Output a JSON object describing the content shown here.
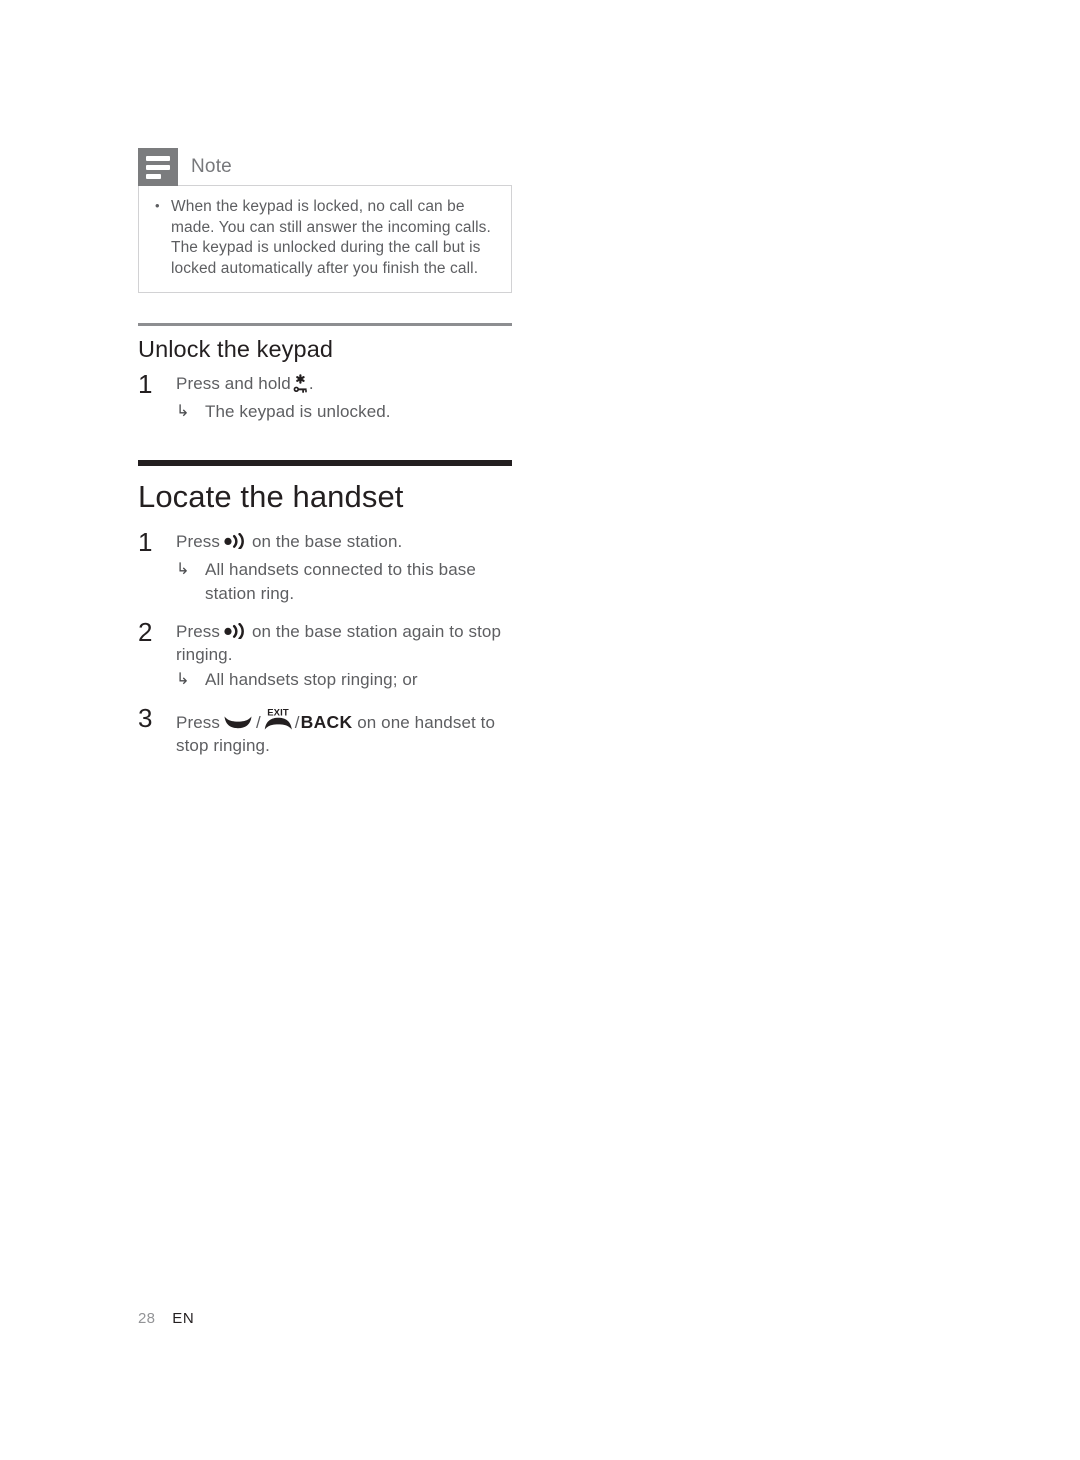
{
  "note": {
    "icon_name": "note-lines-icon",
    "title": "Note",
    "bullets": [
      "When the keypad is locked, no call can be made. You can still answer the incoming calls. The keypad is unlocked during the call but is locked automatically after you finish the call."
    ]
  },
  "section_unlock": {
    "heading": "Unlock the keypad",
    "steps": [
      {
        "number": "1",
        "text_before": "Press and hold",
        "icon": "star-key-icon",
        "text_after": ".",
        "result_arrow": "↳",
        "result": "The keypad is unlocked."
      }
    ]
  },
  "section_locate": {
    "heading": "Locate the handset",
    "steps": [
      {
        "number": "1",
        "text_before": "Press",
        "icon": "paging-icon",
        "text_after": "on the base station.",
        "result_arrow": "↳",
        "result": "All handsets connected to this base station ring."
      },
      {
        "number": "2",
        "text_before": "Press",
        "icon": "paging-icon",
        "text_after": "on the base station again to stop ringing.",
        "result_arrow": "↳",
        "result": "All handsets stop ringing; or"
      },
      {
        "number": "3",
        "text_before": "Press",
        "icon_talk": "talk-handset-icon",
        "separator1": "/",
        "icon_exit": "exit-handset-icon",
        "exit_caption": "EXIT",
        "separator2": "/",
        "keyword": "BACK",
        "text_after": "on one handset to stop ringing."
      }
    ]
  },
  "footer": {
    "page_number": "28",
    "language": "EN"
  },
  "colors": {
    "heading": "#231f20",
    "body_text": "#5d5e61",
    "note_icon_bg": "#7b7c7e",
    "note_border": "#d2d2d4",
    "rule_thin": "#8d8e91",
    "rule_thick": "#231f20",
    "footer_page": "#939497"
  }
}
